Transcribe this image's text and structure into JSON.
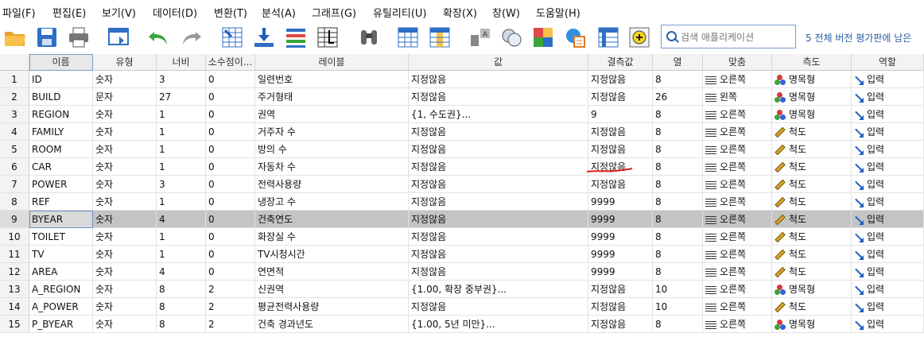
{
  "menu": [
    "파일(F)",
    "편집(E)",
    "보기(V)",
    "데이터(D)",
    "변환(T)",
    "분석(A)",
    "그래프(G)",
    "유틸리티(U)",
    "확장(X)",
    "창(W)",
    "도움말(H)"
  ],
  "toolbar": {
    "open": "open-folder-icon",
    "save": "save-icon",
    "print": "print-icon",
    "dialog": "dialog-recall-icon",
    "undo": "undo-icon",
    "redo": "redo-icon",
    "goto_case": "goto-case-icon",
    "goto_var": "goto-variable-icon",
    "variables": "variables-icon",
    "run_descriptives": "descriptives-icon",
    "find": "find-binoculars-icon",
    "insert_cases": "insert-cases-icon",
    "insert_variable": "insert-variable-icon",
    "split_file": "split-file-icon",
    "weight_cases": "weight-cases-icon",
    "select_cases": "select-cases-icon",
    "value_labels": "value-labels-icon",
    "use_sets": "use-sets-icon",
    "customize": "add-on-icon"
  },
  "search": {
    "placeholder": "검색 애플리케이션"
  },
  "trial_text": "5 전체 버전 평가판에 남은",
  "headers": [
    "",
    "이름",
    "유형",
    "너비",
    "소수점이...",
    "레이블",
    "값",
    "결측값",
    "열",
    "맞춤",
    "측도",
    "역할"
  ],
  "colors": {
    "nominal_red": "#d63a3a",
    "nominal_green": "#3aa53a",
    "nominal_blue": "#3a5fd6",
    "role_arrow": "#1f5fc0",
    "selected_row": "#c4c4c4"
  },
  "rows": [
    {
      "n": "1",
      "name": "ID",
      "type": "숫자",
      "width": "3",
      "dec": "0",
      "label": "일련번호",
      "values": "지정않음",
      "missing": "지정않음",
      "cols": "8",
      "align": "오른쪽",
      "measure": "명목형",
      "measure_kind": "nominal",
      "role": "입력"
    },
    {
      "n": "2",
      "name": "BUILD",
      "type": "문자",
      "width": "27",
      "dec": "0",
      "label": "주거형태",
      "values": "지정않음",
      "missing": "지정않음",
      "cols": "26",
      "align": "왼쪽",
      "measure": "명목형",
      "measure_kind": "nominal",
      "role": "입력"
    },
    {
      "n": "3",
      "name": "REGION",
      "type": "숫자",
      "width": "1",
      "dec": "0",
      "label": "권역",
      "values": "{1, 수도권}...",
      "missing": "9",
      "cols": "8",
      "align": "오른쪽",
      "measure": "명목형",
      "measure_kind": "nominal",
      "role": "입력"
    },
    {
      "n": "4",
      "name": "FAMILY",
      "type": "숫자",
      "width": "1",
      "dec": "0",
      "label": "거주자 수",
      "values": "지정않음",
      "missing": "지정않음",
      "cols": "8",
      "align": "오른쪽",
      "measure": "척도",
      "measure_kind": "scale",
      "role": "입력"
    },
    {
      "n": "5",
      "name": "ROOM",
      "type": "숫자",
      "width": "1",
      "dec": "0",
      "label": "방의 수",
      "values": "지정않음",
      "missing": "지정않음",
      "cols": "8",
      "align": "오른쪽",
      "measure": "척도",
      "measure_kind": "scale",
      "role": "입력"
    },
    {
      "n": "6",
      "name": "CAR",
      "type": "숫자",
      "width": "1",
      "dec": "0",
      "label": "자동차 수",
      "values": "지정않음",
      "missing": "지정않음",
      "cols": "8",
      "align": "오른쪽",
      "measure": "척도",
      "measure_kind": "scale",
      "role": "입력"
    },
    {
      "n": "7",
      "name": "POWER",
      "type": "숫자",
      "width": "3",
      "dec": "0",
      "label": "전력사용량",
      "values": "지정않음",
      "missing": "지정않음",
      "cols": "8",
      "align": "오른쪽",
      "measure": "척도",
      "measure_kind": "scale",
      "role": "입력"
    },
    {
      "n": "8",
      "name": "REF",
      "type": "숫자",
      "width": "1",
      "dec": "0",
      "label": "냉장고 수",
      "values": "지정않음",
      "missing": "9999",
      "cols": "8",
      "align": "오른쪽",
      "measure": "척도",
      "measure_kind": "scale",
      "role": "입력"
    },
    {
      "n": "9",
      "name": "BYEAR",
      "type": "숫자",
      "width": "4",
      "dec": "0",
      "label": "건축연도",
      "values": "지정않음",
      "missing": "9999",
      "cols": "8",
      "align": "오른쪽",
      "measure": "척도",
      "measure_kind": "scale",
      "role": "입력",
      "selected": true
    },
    {
      "n": "10",
      "name": "TOILET",
      "type": "숫자",
      "width": "1",
      "dec": "0",
      "label": "화장실 수",
      "values": "지정않음",
      "missing": "9999",
      "cols": "8",
      "align": "오른쪽",
      "measure": "척도",
      "measure_kind": "scale",
      "role": "입력"
    },
    {
      "n": "11",
      "name": "TV",
      "type": "숫자",
      "width": "1",
      "dec": "0",
      "label": "TV시청시간",
      "values": "지정않음",
      "missing": "9999",
      "cols": "8",
      "align": "오른쪽",
      "measure": "척도",
      "measure_kind": "scale",
      "role": "입력"
    },
    {
      "n": "12",
      "name": "AREA",
      "type": "숫자",
      "width": "4",
      "dec": "0",
      "label": "연면적",
      "values": "지정않음",
      "missing": "9999",
      "cols": "8",
      "align": "오른쪽",
      "measure": "척도",
      "measure_kind": "scale",
      "role": "입력"
    },
    {
      "n": "13",
      "name": "A_REGION",
      "type": "숫자",
      "width": "8",
      "dec": "2",
      "label": "신권역",
      "values": "{1.00, 확장 중부권}...",
      "missing": "지정않음",
      "cols": "10",
      "align": "오른쪽",
      "measure": "명목형",
      "measure_kind": "nominal",
      "role": "입력"
    },
    {
      "n": "14",
      "name": "A_POWER",
      "type": "숫자",
      "width": "8",
      "dec": "2",
      "label": "평균전력사용량",
      "values": "지정않음",
      "missing": "지정않음",
      "cols": "10",
      "align": "오른쪽",
      "measure": "척도",
      "measure_kind": "scale",
      "role": "입력"
    },
    {
      "n": "15",
      "name": "P_BYEAR",
      "type": "숫자",
      "width": "8",
      "dec": "2",
      "label": "건축 경과년도",
      "values": "{1.00, 5년 미만}...",
      "missing": "지정않음",
      "cols": "8",
      "align": "오른쪽",
      "measure": "명목형",
      "measure_kind": "nominal",
      "role": "입력"
    }
  ]
}
